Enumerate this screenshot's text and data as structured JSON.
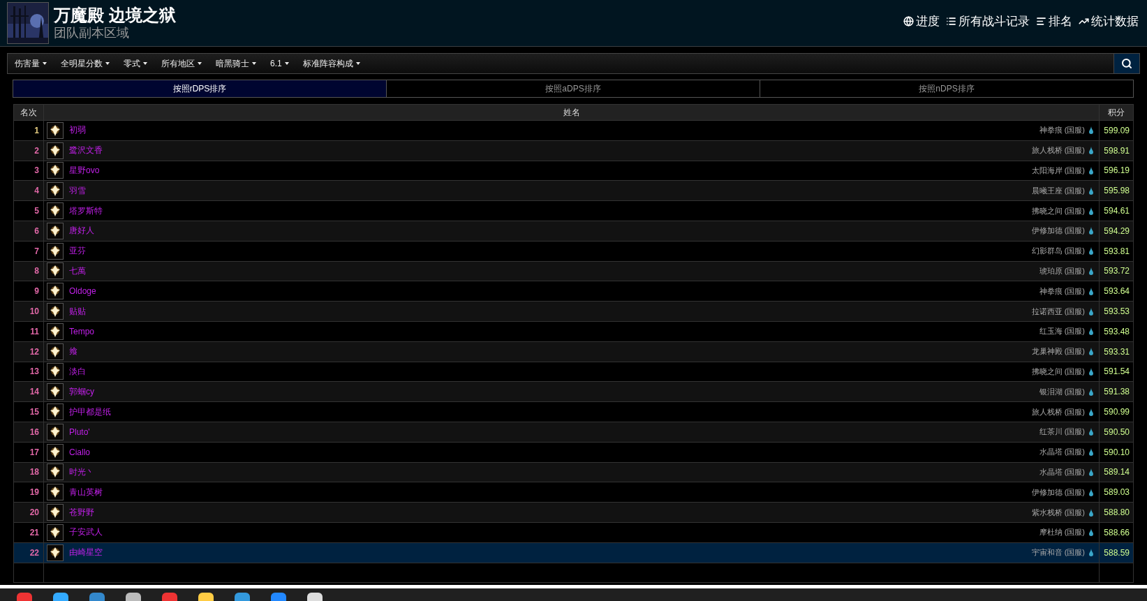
{
  "header": {
    "title": "万魔殿 边境之狱",
    "subtitle": "团队副本区域",
    "nav": [
      {
        "kind": "globe",
        "label": "进度"
      },
      {
        "kind": "list",
        "label": "所有战斗记录"
      },
      {
        "kind": "sort",
        "label": "排名"
      },
      {
        "kind": "trend",
        "label": "统计数据"
      }
    ]
  },
  "filters": [
    "伤害量",
    "全明星分数",
    "零式",
    "所有地区",
    "暗黑骑士",
    "6.1",
    "标准阵容构成"
  ],
  "tabs": [
    {
      "label": "按照rDPS排序",
      "selected": true
    },
    {
      "label": "按照aDPS排序",
      "selected": false
    },
    {
      "label": "按照nDPS排序",
      "selected": false
    }
  ],
  "table": {
    "columns": [
      "名次",
      "姓名",
      "积分"
    ],
    "rows": [
      {
        "rank": "1",
        "color": "#e5cc80",
        "name": "初弱",
        "server": "神拳痕 (国服)",
        "score": "599.09",
        "selected": false
      },
      {
        "rank": "2",
        "color": "#e268a8",
        "name": "鹭沢文香",
        "server": "旅人栈桥 (国服)",
        "score": "598.91",
        "selected": false
      },
      {
        "rank": "3",
        "color": "#e268a8",
        "name": "星野ovo",
        "server": "太阳海岸 (国服)",
        "score": "596.19",
        "selected": false
      },
      {
        "rank": "4",
        "color": "#e268a8",
        "name": "羽雪",
        "server": "晨曦王座 (国服)",
        "score": "595.98",
        "selected": false
      },
      {
        "rank": "5",
        "color": "#e268a8",
        "name": "塔罗斯特",
        "server": "拂晓之间 (国服)",
        "score": "594.61",
        "selected": false
      },
      {
        "rank": "6",
        "color": "#e268a8",
        "name": "唐好人",
        "server": "伊修加德 (国服)",
        "score": "594.29",
        "selected": false
      },
      {
        "rank": "7",
        "color": "#e268a8",
        "name": "亚芬",
        "server": "幻影群岛 (国服)",
        "score": "593.81",
        "selected": false
      },
      {
        "rank": "8",
        "color": "#e268a8",
        "name": "七萬",
        "server": "琥珀原 (国服)",
        "score": "593.72",
        "selected": false
      },
      {
        "rank": "9",
        "color": "#e268a8",
        "name": "Oldoge",
        "server": "神拳痕 (国服)",
        "score": "593.64",
        "selected": false
      },
      {
        "rank": "10",
        "color": "#e268a8",
        "name": "贴贴",
        "server": "拉诺西亚 (国服)",
        "score": "593.53",
        "selected": false
      },
      {
        "rank": "11",
        "color": "#e268a8",
        "name": "Tempo",
        "server": "红玉海 (国服)",
        "score": "593.48",
        "selected": false
      },
      {
        "rank": "12",
        "color": "#e268a8",
        "name": "飨",
        "server": "龙巢神殿 (国服)",
        "score": "593.31",
        "selected": false
      },
      {
        "rank": "13",
        "color": "#e268a8",
        "name": "淡白",
        "server": "拂晓之间 (国服)",
        "score": "591.54",
        "selected": false
      },
      {
        "rank": "14",
        "color": "#e268a8",
        "name": "郭蝈cy",
        "server": "银泪湖 (国服)",
        "score": "591.38",
        "selected": false
      },
      {
        "rank": "15",
        "color": "#e268a8",
        "name": "护甲都是纸",
        "server": "旅人栈桥 (国服)",
        "score": "590.99",
        "selected": false
      },
      {
        "rank": "16",
        "color": "#e268a8",
        "name": "Pluto'",
        "server": "红茶川 (国服)",
        "score": "590.50",
        "selected": false
      },
      {
        "rank": "17",
        "color": "#e268a8",
        "name": "Ciallo",
        "server": "水晶塔 (国服)",
        "score": "590.10",
        "selected": false
      },
      {
        "rank": "18",
        "color": "#e268a8",
        "name": "时光丶",
        "server": "水晶塔 (国服)",
        "score": "589.14",
        "selected": false
      },
      {
        "rank": "19",
        "color": "#e268a8",
        "name": "青山英树",
        "server": "伊修加德 (国服)",
        "score": "589.03",
        "selected": false
      },
      {
        "rank": "20",
        "color": "#e268a8",
        "name": "苍野野",
        "server": "紫水栈桥 (国服)",
        "score": "588.80",
        "selected": false
      },
      {
        "rank": "21",
        "color": "#e268a8",
        "name": "子安武人",
        "server": "摩杜纳 (国服)",
        "score": "588.66",
        "selected": false
      },
      {
        "rank": "22",
        "color": "#e268a8",
        "name": "由崎星空",
        "server": "宇宙和音 (国服)",
        "score": "588.59",
        "selected": true
      }
    ]
  }
}
